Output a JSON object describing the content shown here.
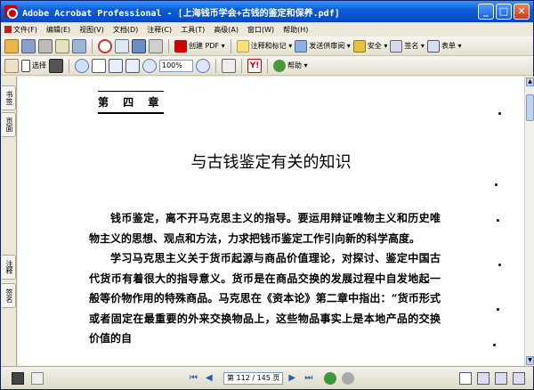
{
  "window": {
    "title": "Adobe Acrobat Professional - [上海钱币学会+古钱的鉴定和保养.pdf]",
    "controls": {
      "minimize": "_",
      "maximize": "□",
      "close": "✕"
    }
  },
  "menubar": {
    "items": [
      "文件(F)",
      "编辑(E)",
      "视图(V)",
      "文档(D)",
      "注释(C)",
      "工具(T)",
      "高级(A)",
      "窗口(W)",
      "帮助(H)"
    ]
  },
  "toolbar1": {
    "create_pdf": "创建 PDF ▾",
    "comment": "注释和标记 ▾",
    "send_review": "发送供审阅 ▾",
    "secure": "安全 ▾",
    "sign": "签名 ▾",
    "forms": "表单 ▾"
  },
  "toolbar2": {
    "select": "选择",
    "zoom_value": "100%",
    "help": "帮助 ▾"
  },
  "sidebar": {
    "tabs": [
      "书签",
      "页面",
      "注释",
      "签名"
    ]
  },
  "document": {
    "chapter": "第 四 章",
    "heading": "与古钱鉴定有关的知识",
    "paragraphs": [
      "钱币鉴定，离不开马克思主义的指导。要运用辩证唯物主义和历史唯物主义的思想、观点和方法，力求把钱币鉴定工作引向新的科学高度。",
      "学习马克思主义关于货币起源与商品价值理论，对探讨、鉴定中国古代货币有着很大的指导意义。货币是在商品交换的发展过程中自发地起一般等价物作用的特殊商品。马克思在《资本论》第二章中指出：“货币形式或者固定在最重要的外来交换物品上，这些物品事实上是本地产品的交换价值的自"
    ]
  },
  "statusbar": {
    "page_indicator": "第 112 / 145 页"
  },
  "colors": {
    "titlebar": "#0848c4",
    "acrobat_red": "#cc0000"
  }
}
